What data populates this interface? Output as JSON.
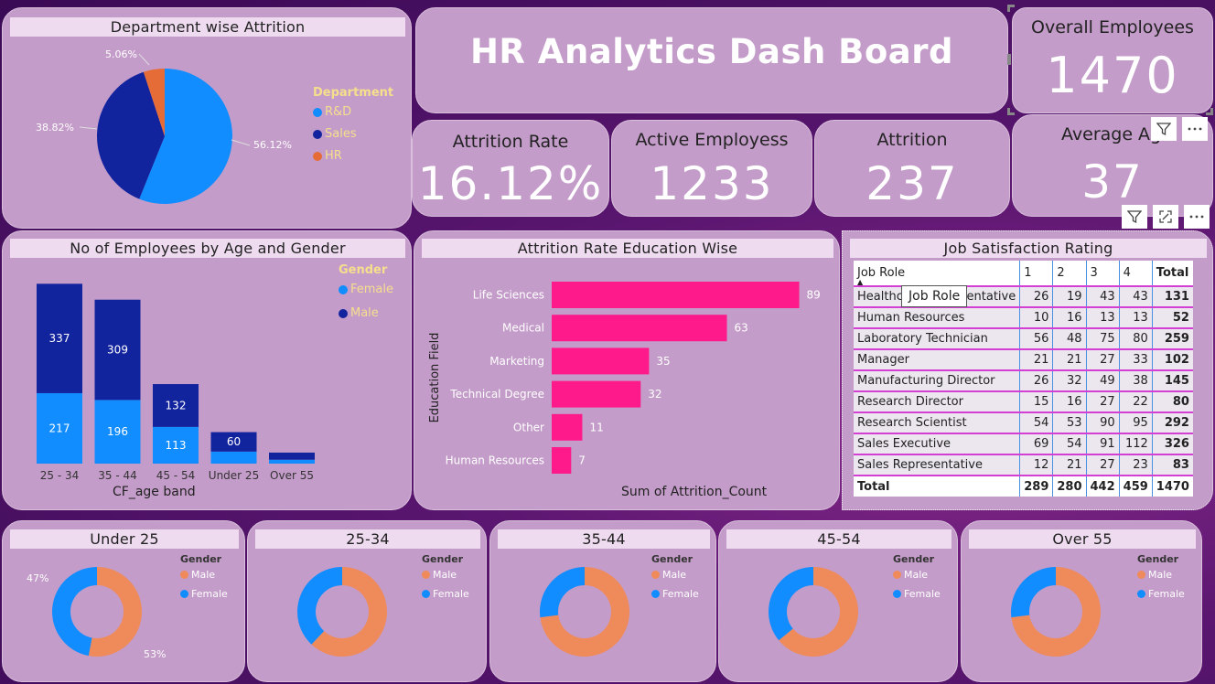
{
  "header": {
    "title": "HR Analytics Dash Board"
  },
  "kpis": {
    "overall_employees": {
      "label": "Overall Employees",
      "value": "1470"
    },
    "attrition_rate": {
      "label": "Attrition Rate",
      "value": "16.12%"
    },
    "active_employees": {
      "label": "Active Employess",
      "value": "1233"
    },
    "attrition": {
      "label": "Attrition",
      "value": "237"
    },
    "average_age": {
      "label": "Average Ag",
      "value": "37"
    }
  },
  "icons": {
    "filter": "filter-icon",
    "more": "more-options-icon",
    "expand": "focus-mode-icon"
  },
  "department_chart": {
    "title": "Department wise Attrition",
    "legend_title": "Department",
    "labels": [
      "56.12%",
      "38.82%",
      "5.06%"
    ]
  },
  "age_gender_chart": {
    "title": "No of Employees by Age and Gender",
    "legend_title": "Gender",
    "legend": [
      "Female",
      "Male"
    ],
    "xlabel": "CF_age band"
  },
  "education_chart": {
    "title": "Attrition Rate Education Wise",
    "ylabel": "Education Field",
    "xlabel": "Sum of Attrition_Count"
  },
  "job_satisfaction": {
    "title": "Job Satisfaction Rating",
    "columns": [
      "Job Role",
      "1",
      "2",
      "3",
      "4",
      "Total"
    ],
    "tooltip": "Job Role",
    "rows": [
      [
        "Healthcare Representative",
        "26",
        "19",
        "43",
        "43",
        "131"
      ],
      [
        "Human Resources",
        "10",
        "16",
        "13",
        "13",
        "52"
      ],
      [
        "Laboratory Technician",
        "56",
        "48",
        "75",
        "80",
        "259"
      ],
      [
        "Manager",
        "21",
        "21",
        "27",
        "33",
        "102"
      ],
      [
        "Manufacturing Director",
        "26",
        "32",
        "49",
        "38",
        "145"
      ],
      [
        "Research Director",
        "15",
        "16",
        "27",
        "22",
        "80"
      ],
      [
        "Research Scientist",
        "54",
        "53",
        "90",
        "95",
        "292"
      ],
      [
        "Sales Executive",
        "69",
        "54",
        "91",
        "112",
        "326"
      ],
      [
        "Sales Representative",
        "12",
        "21",
        "27",
        "23",
        "83"
      ]
    ],
    "total": [
      "Total",
      "289",
      "280",
      "442",
      "459",
      "1470"
    ]
  },
  "donuts": [
    {
      "title": "Under 25",
      "legend_title": "Gender",
      "legend": [
        "Male",
        "Female"
      ],
      "male_label": "53%",
      "female_label": "47%"
    },
    {
      "title": "25-34",
      "legend_title": "Gender",
      "legend": [
        "Male",
        "Female"
      ],
      "male_label": "62%",
      "female_label": "38%"
    },
    {
      "title": "35-44",
      "legend_title": "Gender",
      "legend": [
        "Male",
        "Female"
      ],
      "male_label": "73%",
      "female_label": "27%"
    },
    {
      "title": "45-54",
      "legend_title": "Gender",
      "legend": [
        "Male",
        "Female"
      ],
      "male_label": "64%",
      "female_label": "36%"
    },
    {
      "title": "Over 55",
      "legend_title": "Gender",
      "legend": [
        "Male",
        "Female"
      ],
      "male_label": "73%",
      "female_label": "27%"
    }
  ],
  "colors": {
    "rd": "#118dff",
    "sales": "#12239e",
    "hr": "#e66c37",
    "female": "#118dff",
    "male": "#12239e",
    "education_bar": "#ff1a8c",
    "donut_male": "#ef8a5a",
    "donut_female": "#118dff",
    "legend_text": "#f5df8c"
  },
  "chart_data": [
    {
      "type": "pie",
      "title": "Department wise Attrition",
      "categories": [
        "R&D",
        "Sales",
        "HR"
      ],
      "values": [
        56.12,
        38.82,
        5.06
      ],
      "legend": "right"
    },
    {
      "type": "bar",
      "title": "No of Employees by Age and Gender",
      "categories": [
        "25 - 34",
        "35 - 44",
        "45 - 54",
        "Under 25",
        "Over 55"
      ],
      "series": [
        {
          "name": "Female",
          "values": [
            217,
            196,
            113,
            37,
            12
          ]
        },
        {
          "name": "Male",
          "values": [
            337,
            309,
            132,
            60,
            22
          ]
        }
      ],
      "xlabel": "CF_age band",
      "stacked": true,
      "legend": "top-right"
    },
    {
      "type": "bar",
      "orientation": "horizontal",
      "title": "Attrition Rate Education Wise",
      "categories": [
        "Life Sciences",
        "Medical",
        "Marketing",
        "Technical Degree",
        "Other",
        "Human Resources"
      ],
      "values": [
        89,
        63,
        35,
        32,
        11,
        7
      ],
      "xlabel": "Sum of Attrition_Count",
      "ylabel": "Education Field"
    },
    {
      "type": "pie",
      "title": "Under 25",
      "categories": [
        "Male",
        "Female"
      ],
      "values": [
        53,
        47
      ],
      "donut": true
    },
    {
      "type": "pie",
      "title": "25-34",
      "categories": [
        "Male",
        "Female"
      ],
      "values": [
        62,
        38
      ],
      "donut": true
    },
    {
      "type": "pie",
      "title": "35-44",
      "categories": [
        "Male",
        "Female"
      ],
      "values": [
        73,
        27
      ],
      "donut": true
    },
    {
      "type": "pie",
      "title": "45-54",
      "categories": [
        "Male",
        "Female"
      ],
      "values": [
        64,
        36
      ],
      "donut": true
    },
    {
      "type": "pie",
      "title": "Over 55",
      "categories": [
        "Male",
        "Female"
      ],
      "values": [
        73,
        27
      ],
      "donut": true
    }
  ]
}
